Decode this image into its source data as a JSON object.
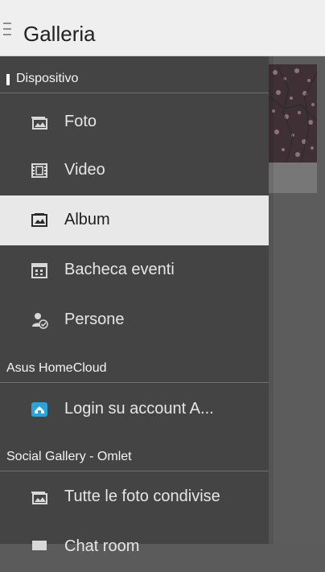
{
  "app_bar": {
    "title": "Galleria",
    "menu_icon": "hamburger-menu-icon"
  },
  "drawer": {
    "sections": [
      {
        "label": "Dispositivo",
        "items": [
          {
            "label": "Foto",
            "icon": "photo-icon",
            "active": false
          },
          {
            "label": "Video",
            "icon": "film-icon",
            "active": false
          },
          {
            "label": "Album",
            "icon": "album-icon",
            "active": true
          },
          {
            "label": "Bacheca eventi",
            "icon": "calendar-icon",
            "active": false
          },
          {
            "label": "Persone",
            "icon": "person-check-icon",
            "active": false
          }
        ]
      },
      {
        "label": "Asus HomeCloud",
        "items": [
          {
            "label": "Login su account A...",
            "icon": "homecloud-icon",
            "active": false
          }
        ]
      },
      {
        "label": "Social Gallery - Omlet",
        "items": [
          {
            "label": "Tutte le foto condivise",
            "icon": "photo-icon",
            "active": false
          },
          {
            "label": "Chat room",
            "icon": "chat-icon",
            "active": false
          }
        ]
      }
    ]
  },
  "colors": {
    "drawer_bg": "#444444",
    "active_item_bg": "#e8e8e8",
    "app_bar_bg": "#efefef",
    "homecloud_blue": "#2aa3dc"
  }
}
